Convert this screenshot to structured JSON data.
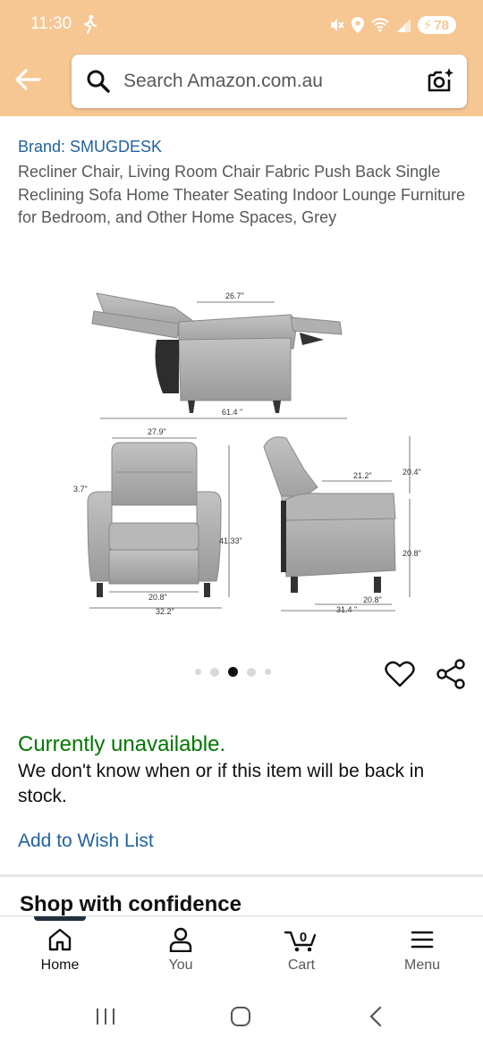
{
  "status_bar": {
    "time": "11:30",
    "battery": "78"
  },
  "search": {
    "placeholder": "Search Amazon.com.au"
  },
  "product": {
    "brand": "Brand: SMUGDESK",
    "title": "Recliner Chair, Living Room Chair Fabric Push Back Single Reclining Sofa Home Theater Seating Indoor Lounge Furniture for Bedroom, and Other Home Spaces, Grey",
    "dimensions": {
      "top_seat": "26.7\"",
      "top_length": "61.4 \"",
      "front_top": "27.9\"",
      "front_arm": "3.7\"",
      "front_height": "41.33\"",
      "front_seat": "20.8\"",
      "front_width": "32.2\"",
      "side_seat": "21.2\"",
      "side_back": "20.4\"",
      "side_height": "20.8\"",
      "side_seat_depth": "20.8\"",
      "side_depth": "31.4 \""
    },
    "image_carousel": {
      "count": 5,
      "active_index": 2
    }
  },
  "availability": {
    "status": "Currently unavailable.",
    "message": "We don't know when or if this item will be back in stock.",
    "wishlist_label": "Add to Wish List"
  },
  "section_heading": "Shop with confidence",
  "bottom_nav": [
    {
      "label": "Home",
      "icon": "home-icon"
    },
    {
      "label": "You",
      "icon": "person-icon"
    },
    {
      "label": "Cart",
      "icon": "cart-icon",
      "badge": "0"
    },
    {
      "label": "Menu",
      "icon": "menu-icon"
    }
  ],
  "colors": {
    "header": "#f6c793",
    "link": "#2162a1",
    "available": "#007600"
  }
}
